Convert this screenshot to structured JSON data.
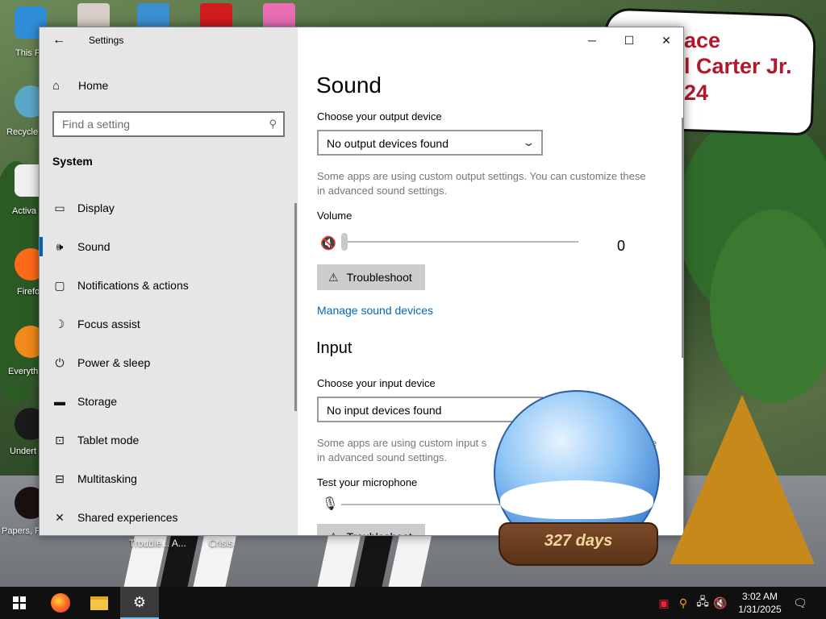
{
  "window": {
    "title": "Settings",
    "back_icon": "arrow-left-icon",
    "controls": {
      "minimize": "─",
      "maximize": "☐",
      "close": "✕"
    }
  },
  "sidebar": {
    "home_label": "Home",
    "search_placeholder": "Find a setting",
    "section_label": "System",
    "items": [
      {
        "label": "Display",
        "icon": "monitor-icon",
        "glyph": "▭"
      },
      {
        "label": "Sound",
        "icon": "speaker-icon",
        "glyph": "🔊",
        "active": true
      },
      {
        "label": "Notifications & actions",
        "icon": "notification-icon",
        "glyph": "▢"
      },
      {
        "label": "Focus assist",
        "icon": "moon-icon",
        "glyph": "☽"
      },
      {
        "label": "Power & sleep",
        "icon": "power-icon",
        "glyph": "⏻"
      },
      {
        "label": "Storage",
        "icon": "storage-icon",
        "glyph": "▬"
      },
      {
        "label": "Tablet mode",
        "icon": "tablet-icon",
        "glyph": "⊡"
      },
      {
        "label": "Multitasking",
        "icon": "multitasking-icon",
        "glyph": "⊟"
      },
      {
        "label": "Shared experiences",
        "icon": "shared-icon",
        "glyph": "✕"
      }
    ]
  },
  "main": {
    "title": "Sound",
    "output": {
      "label": "Choose your output device",
      "selected": "No output devices found",
      "note": "Some apps are using custom output settings. You can customize these in advanced sound settings."
    },
    "volume": {
      "label": "Volume",
      "value": "0",
      "level": 0,
      "icon": "speaker-muted-icon"
    },
    "troubleshoot_label": "Troubleshoot",
    "manage_link": "Manage sound devices",
    "input": {
      "heading": "Input",
      "label": "Choose your input device",
      "selected": "No input devices found",
      "note_visible": "Some apps are using custom input s",
      "note_line2": "in advanced sound settings.",
      "note_tail": "e",
      "test_label": "Test your microphone",
      "mic_icon": "microphone-icon"
    }
  },
  "desktop": {
    "icons": [
      {
        "label": "This P"
      },
      {
        "label": "Recycle"
      },
      {
        "label": "Activa"
      },
      {
        "label": "Firefo"
      },
      {
        "label": "Everyth"
      },
      {
        "label": "Undert"
      },
      {
        "label": "Papers, P"
      }
    ],
    "ghost_labels": [
      "Trouble... A...",
      "Crisis"
    ],
    "speech_bubble": [
      "ace",
      "l Carter Jr.",
      "24"
    ],
    "countdown": "327 days"
  },
  "taskbar": {
    "time": "3:02 AM",
    "date": "1/31/2025",
    "apps": [
      "start-icon",
      "firefox-icon",
      "file-explorer-icon",
      "settings-icon"
    ]
  },
  "colors": {
    "accent": "#0063b1",
    "link": "#0067b8",
    "sidebar_bg": "#e6e6e6",
    "taskbar_bg": "#101010"
  }
}
